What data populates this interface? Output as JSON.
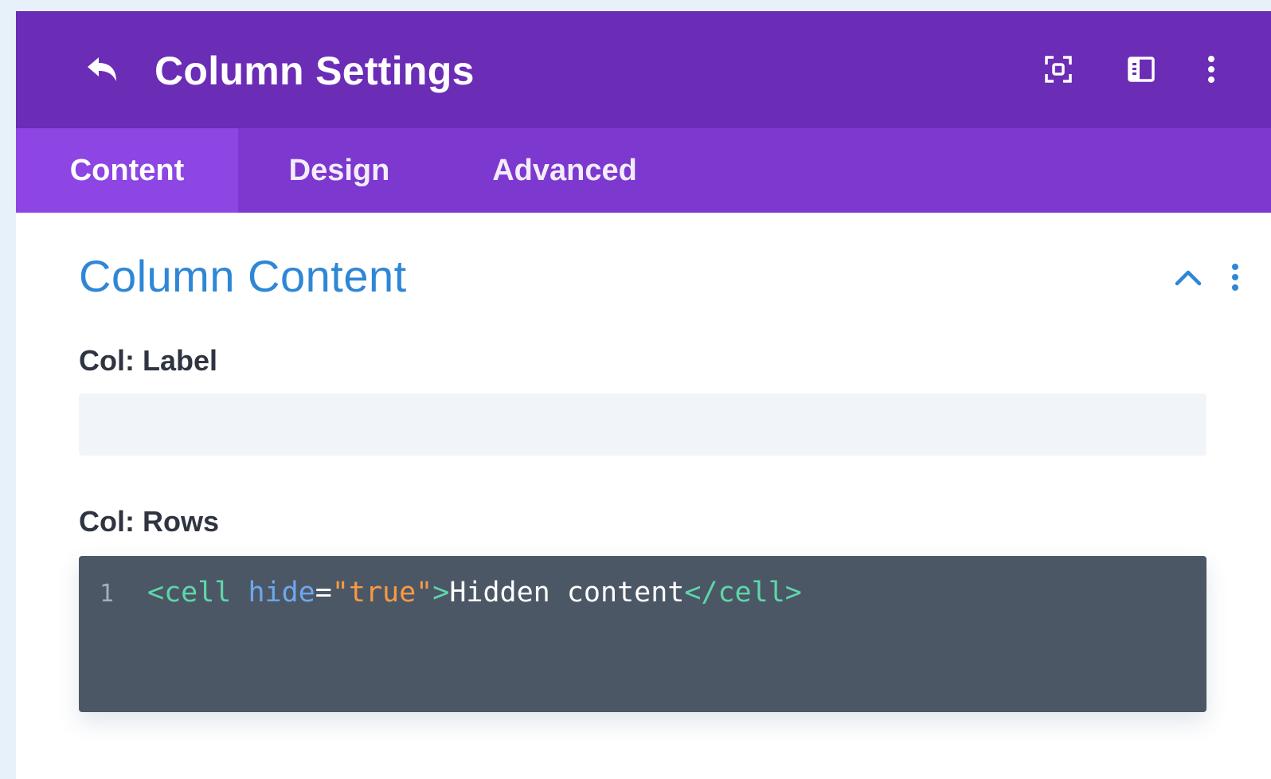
{
  "header": {
    "title": "Column Settings",
    "icons": [
      "back-arrow-icon",
      "focus-expand-icon",
      "sidebar-layout-icon",
      "more-vertical-icon"
    ]
  },
  "tabs": [
    {
      "label": "Content",
      "active": true
    },
    {
      "label": "Design",
      "active": false
    },
    {
      "label": "Advanced",
      "active": false
    }
  ],
  "section": {
    "title": "Column Content",
    "collapsed": false
  },
  "fields": {
    "label": {
      "label": "Col: Label",
      "value": ""
    },
    "rows": {
      "label": "Col: Rows",
      "line_number": "1",
      "code": {
        "open_tag": "<cell",
        "space": " ",
        "attr": "hide",
        "eq": "=",
        "value": "\"true\"",
        "close_bracket": ">",
        "text": "Hidden content",
        "end_tag": "</cell>"
      }
    }
  },
  "colors": {
    "header_bg": "#6b2cb6",
    "tabs_bg": "#7d38cf",
    "active_tab_bg": "#8d45e4",
    "section_title": "#2e87d6",
    "editor_bg": "#4c5766"
  }
}
